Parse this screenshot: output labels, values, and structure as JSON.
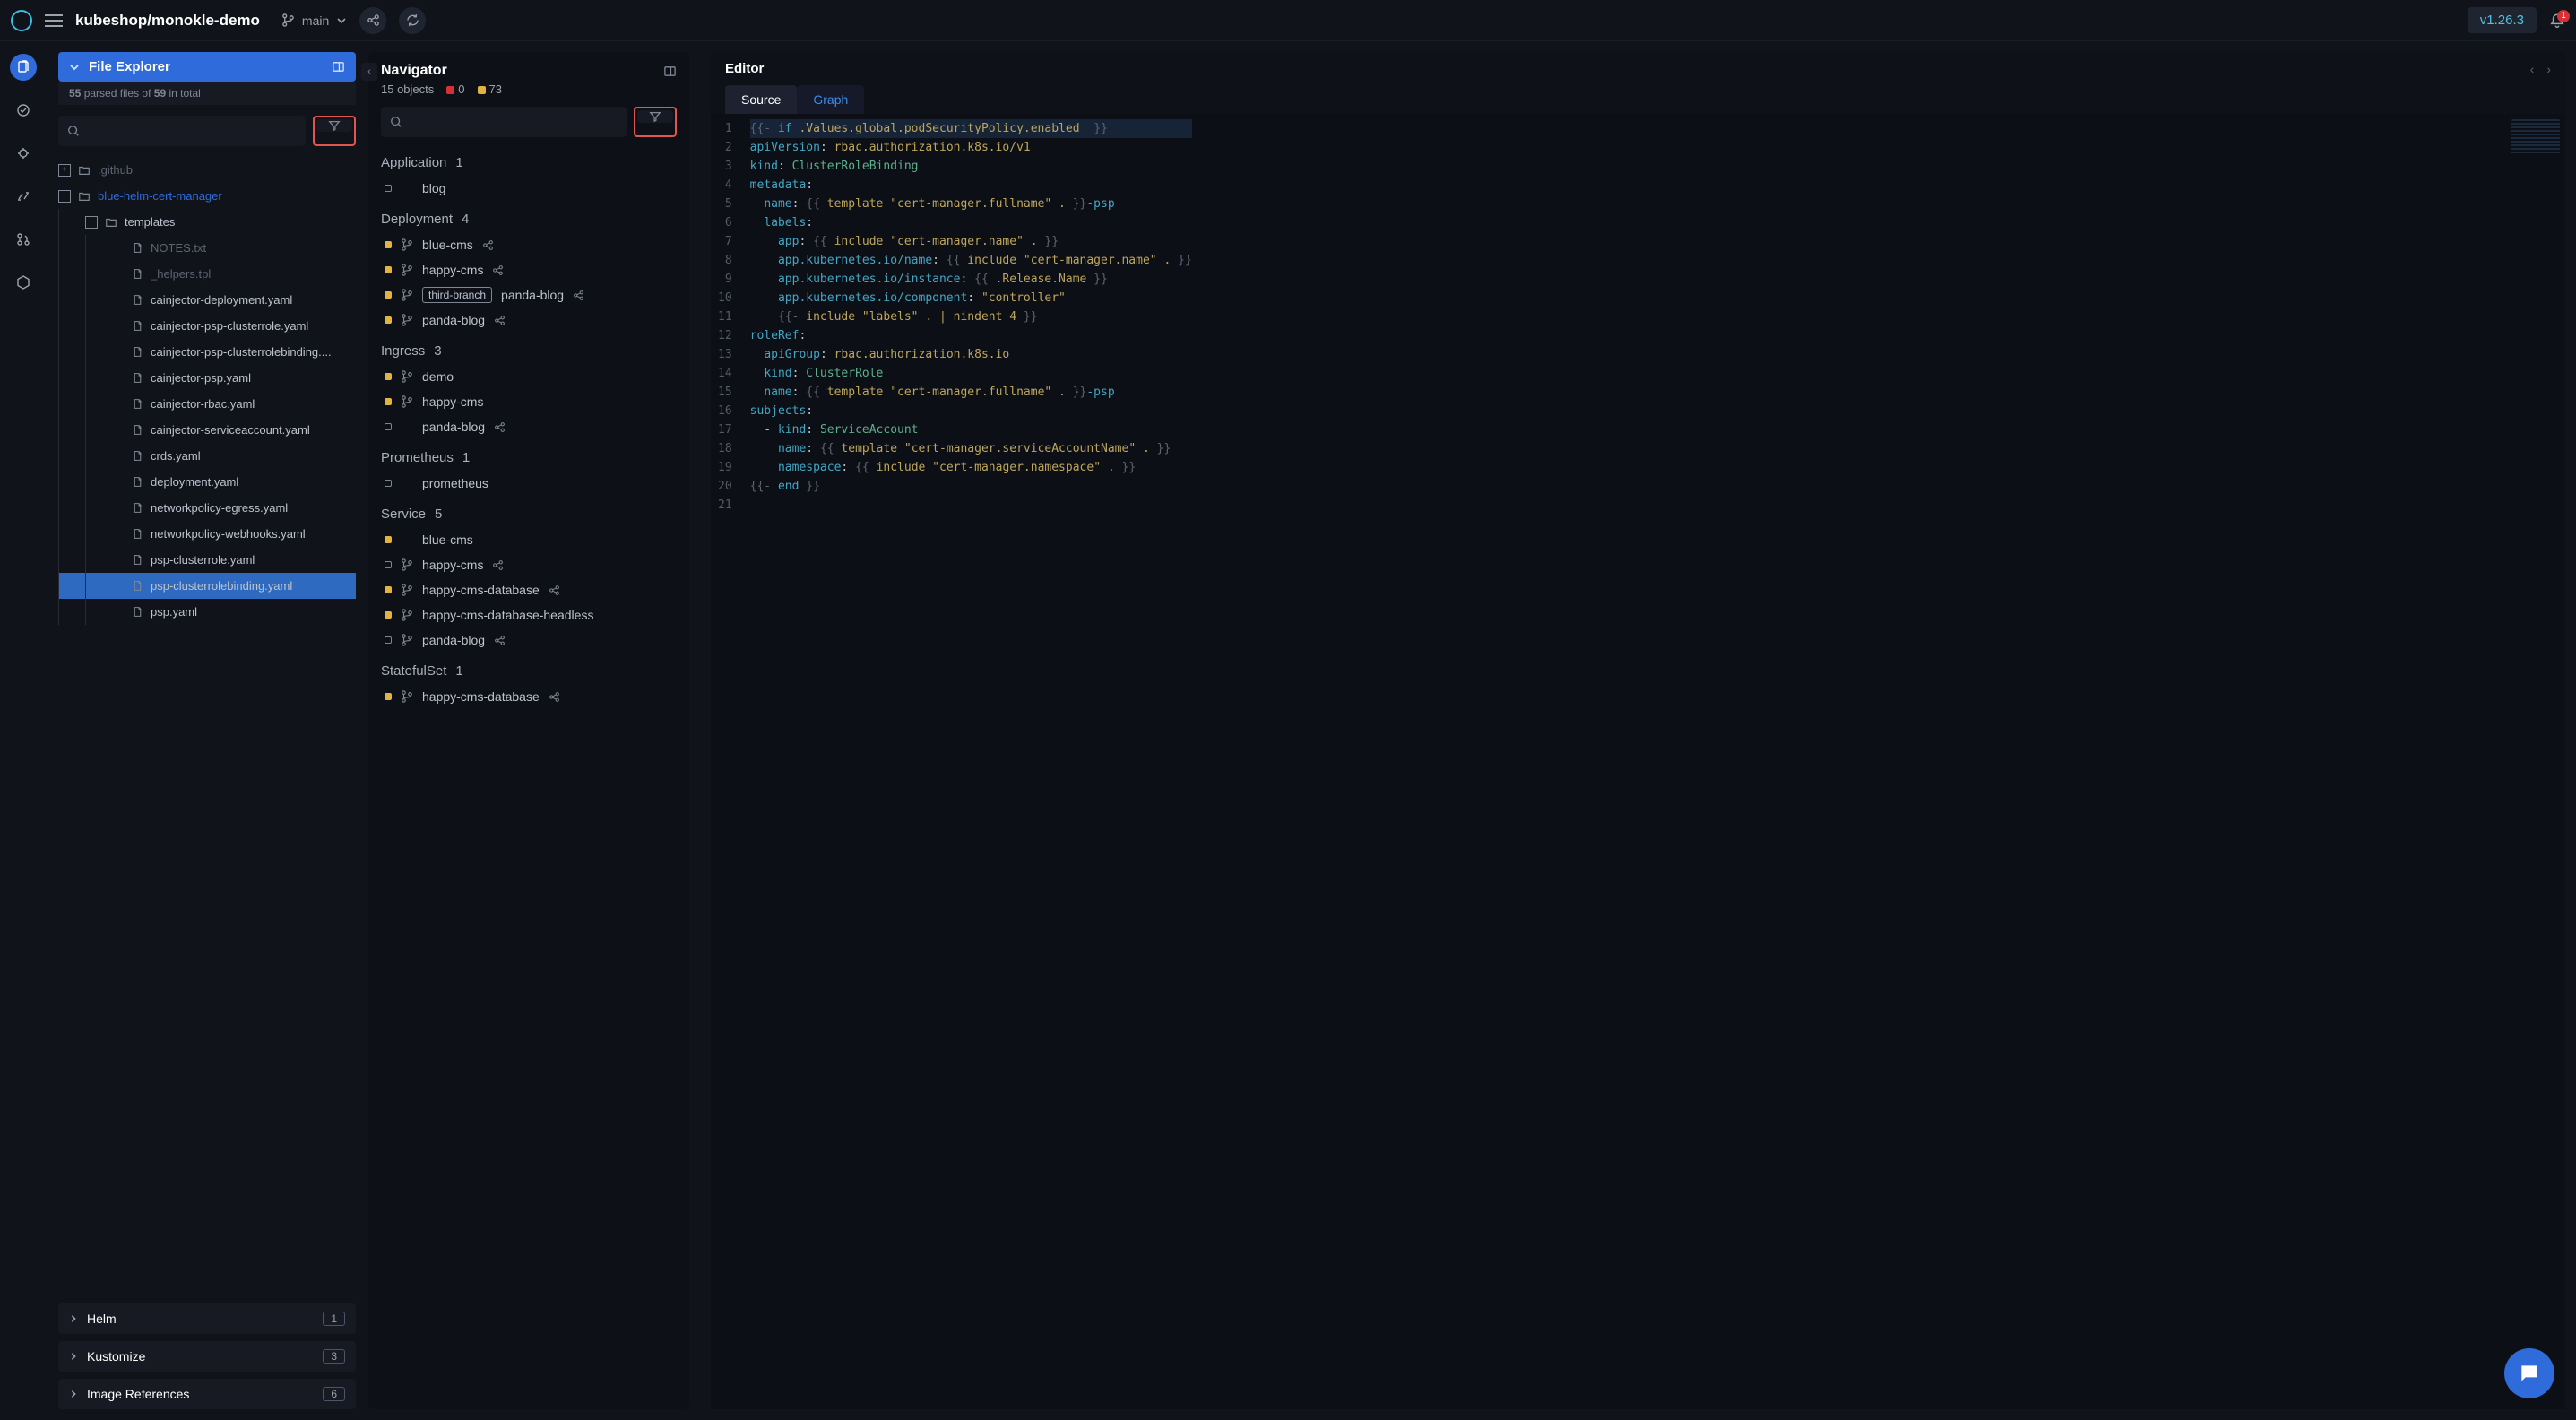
{
  "topbar": {
    "project": "kubeshop/monokle-demo",
    "branch": "main",
    "version": "v1.26.3",
    "notification_count": "1"
  },
  "file_panel": {
    "title": "File Explorer",
    "parsed_line_a": "55",
    "parsed_line_b": "parsed files of",
    "parsed_line_c": "59",
    "parsed_line_d": "in total",
    "tree": [
      {
        "label": ".github",
        "kind": "folder",
        "depth": 0,
        "box": "plus",
        "muted": true
      },
      {
        "label": "blue-helm-cert-manager",
        "kind": "folder",
        "depth": 0,
        "box": "minus",
        "blue": true
      },
      {
        "label": "templates",
        "kind": "folder",
        "depth": 1,
        "box": "minus"
      },
      {
        "label": "NOTES.txt",
        "kind": "file",
        "depth": 2,
        "muted": true
      },
      {
        "label": "_helpers.tpl",
        "kind": "file",
        "depth": 2,
        "muted": true
      },
      {
        "label": "cainjector-deployment.yaml",
        "kind": "file",
        "depth": 2
      },
      {
        "label": "cainjector-psp-clusterrole.yaml",
        "kind": "file",
        "depth": 2
      },
      {
        "label": "cainjector-psp-clusterrolebinding....",
        "kind": "file",
        "depth": 2
      },
      {
        "label": "cainjector-psp.yaml",
        "kind": "file",
        "depth": 2
      },
      {
        "label": "cainjector-rbac.yaml",
        "kind": "file",
        "depth": 2
      },
      {
        "label": "cainjector-serviceaccount.yaml",
        "kind": "file",
        "depth": 2
      },
      {
        "label": "crds.yaml",
        "kind": "file",
        "depth": 2
      },
      {
        "label": "deployment.yaml",
        "kind": "file",
        "depth": 2
      },
      {
        "label": "networkpolicy-egress.yaml",
        "kind": "file",
        "depth": 2
      },
      {
        "label": "networkpolicy-webhooks.yaml",
        "kind": "file",
        "depth": 2
      },
      {
        "label": "psp-clusterrole.yaml",
        "kind": "file",
        "depth": 2
      },
      {
        "label": "psp-clusterrolebinding.yaml",
        "kind": "file",
        "depth": 2,
        "selected": true
      },
      {
        "label": "psp.yaml",
        "kind": "file",
        "depth": 2
      }
    ],
    "accordions": [
      {
        "title": "Helm",
        "count": "1"
      },
      {
        "title": "Kustomize",
        "count": "3"
      },
      {
        "title": "Image References",
        "count": "6"
      }
    ]
  },
  "navigator": {
    "title": "Navigator",
    "objects_text": "15 objects",
    "count_red": "0",
    "count_yellow": "73",
    "groups": [
      {
        "name": "Application",
        "count": "1",
        "items": [
          {
            "label": "blog",
            "dot": "hollow"
          }
        ]
      },
      {
        "name": "Deployment",
        "count": "4",
        "items": [
          {
            "label": "blue-cms",
            "dot": "filled",
            "git": true,
            "share": true
          },
          {
            "label": "happy-cms",
            "dot": "filled",
            "git": true,
            "share": true
          },
          {
            "label": "panda-blog",
            "dot": "filled",
            "git": true,
            "share": true,
            "chip": "third-branch"
          },
          {
            "label": "panda-blog",
            "dot": "filled",
            "git": true,
            "share": true
          }
        ]
      },
      {
        "name": "Ingress",
        "count": "3",
        "items": [
          {
            "label": "demo",
            "dot": "filled",
            "git": true
          },
          {
            "label": "happy-cms",
            "dot": "filled",
            "git": true
          },
          {
            "label": "panda-blog",
            "dot": "hollow",
            "share": true
          }
        ]
      },
      {
        "name": "Prometheus",
        "count": "1",
        "items": [
          {
            "label": "prometheus",
            "dot": "hollow"
          }
        ]
      },
      {
        "name": "Service",
        "count": "5",
        "items": [
          {
            "label": "blue-cms",
            "dot": "filled"
          },
          {
            "label": "happy-cms",
            "dot": "hollow",
            "git": true,
            "share": true
          },
          {
            "label": "happy-cms-database",
            "dot": "filled",
            "git": true,
            "share": true
          },
          {
            "label": "happy-cms-database-headless",
            "dot": "filled",
            "git": true
          },
          {
            "label": "panda-blog",
            "dot": "hollow",
            "git": true,
            "share": true
          }
        ]
      },
      {
        "name": "StatefulSet",
        "count": "1",
        "items": [
          {
            "label": "happy-cms-database",
            "dot": "filled",
            "git": true,
            "share": true
          }
        ]
      }
    ]
  },
  "editor": {
    "title": "Editor",
    "tabs": {
      "source": "Source",
      "graph": "Graph"
    },
    "lines": [
      [
        [
          "c-cond",
          "{{-"
        ],
        [
          "c-punc",
          " "
        ],
        [
          "c-key",
          "if"
        ],
        [
          "c-punc",
          " "
        ],
        [
          "c-str",
          ".Values.global.podSecurityPolicy.enabled"
        ],
        [
          "c-punc",
          "  "
        ],
        [
          "c-cond",
          "}}"
        ]
      ],
      [
        [
          "c-key",
          "apiVersion"
        ],
        [
          "c-punc",
          ": "
        ],
        [
          "c-str",
          "rbac.authorization.k8s.io/v1"
        ]
      ],
      [
        [
          "c-key",
          "kind"
        ],
        [
          "c-punc",
          ": "
        ],
        [
          "c-val",
          "ClusterRoleBinding"
        ]
      ],
      [
        [
          "c-key",
          "metadata"
        ],
        [
          "c-punc",
          ":"
        ]
      ],
      [
        [
          "c-punc",
          "  "
        ],
        [
          "c-key",
          "name"
        ],
        [
          "c-punc",
          ": "
        ],
        [
          "c-cond",
          "{{"
        ],
        [
          "c-punc",
          " "
        ],
        [
          "c-str",
          "template \"cert-manager.fullname\" ."
        ],
        [
          "c-punc",
          " "
        ],
        [
          "c-cond",
          "}}"
        ],
        [
          "c-key",
          "-psp"
        ]
      ],
      [
        [
          "c-punc",
          "  "
        ],
        [
          "c-key",
          "labels"
        ],
        [
          "c-punc",
          ":"
        ]
      ],
      [
        [
          "c-punc",
          "    "
        ],
        [
          "c-key",
          "app"
        ],
        [
          "c-punc",
          ": "
        ],
        [
          "c-cond",
          "{{"
        ],
        [
          "c-punc",
          " "
        ],
        [
          "c-str",
          "include \"cert-manager.name\" ."
        ],
        [
          "c-punc",
          " "
        ],
        [
          "c-cond",
          "}}"
        ]
      ],
      [
        [
          "c-punc",
          "    "
        ],
        [
          "c-key",
          "app.kubernetes.io/name"
        ],
        [
          "c-punc",
          ": "
        ],
        [
          "c-cond",
          "{{"
        ],
        [
          "c-punc",
          " "
        ],
        [
          "c-str",
          "include \"cert-manager.name\" ."
        ],
        [
          "c-punc",
          " "
        ],
        [
          "c-cond",
          "}}"
        ]
      ],
      [
        [
          "c-punc",
          "    "
        ],
        [
          "c-key",
          "app.kubernetes.io/instance"
        ],
        [
          "c-punc",
          ": "
        ],
        [
          "c-cond",
          "{{"
        ],
        [
          "c-punc",
          " "
        ],
        [
          "c-str",
          ".Release.Name"
        ],
        [
          "c-punc",
          " "
        ],
        [
          "c-cond",
          "}}"
        ]
      ],
      [
        [
          "c-punc",
          "    "
        ],
        [
          "c-key",
          "app.kubernetes.io/component"
        ],
        [
          "c-punc",
          ": "
        ],
        [
          "c-str",
          "\"controller\""
        ]
      ],
      [
        [
          "c-punc",
          "    "
        ],
        [
          "c-cond",
          "{{-"
        ],
        [
          "c-punc",
          " "
        ],
        [
          "c-str",
          "include \"labels\" . | nindent 4"
        ],
        [
          "c-punc",
          " "
        ],
        [
          "c-cond",
          "}}"
        ]
      ],
      [
        [
          "c-key",
          "roleRef"
        ],
        [
          "c-punc",
          ":"
        ]
      ],
      [
        [
          "c-punc",
          "  "
        ],
        [
          "c-key",
          "apiGroup"
        ],
        [
          "c-punc",
          ": "
        ],
        [
          "c-str",
          "rbac.authorization.k8s.io"
        ]
      ],
      [
        [
          "c-punc",
          "  "
        ],
        [
          "c-key",
          "kind"
        ],
        [
          "c-punc",
          ": "
        ],
        [
          "c-val",
          "ClusterRole"
        ]
      ],
      [
        [
          "c-punc",
          "  "
        ],
        [
          "c-key",
          "name"
        ],
        [
          "c-punc",
          ": "
        ],
        [
          "c-cond",
          "{{"
        ],
        [
          "c-punc",
          " "
        ],
        [
          "c-str",
          "template \"cert-manager.fullname\" ."
        ],
        [
          "c-punc",
          " "
        ],
        [
          "c-cond",
          "}}"
        ],
        [
          "c-key",
          "-psp"
        ]
      ],
      [
        [
          "c-key",
          "subjects"
        ],
        [
          "c-punc",
          ":"
        ]
      ],
      [
        [
          "c-punc",
          "  - "
        ],
        [
          "c-key",
          "kind"
        ],
        [
          "c-punc",
          ": "
        ],
        [
          "c-val",
          "ServiceAccount"
        ]
      ],
      [
        [
          "c-punc",
          "    "
        ],
        [
          "c-key",
          "name"
        ],
        [
          "c-punc",
          ": "
        ],
        [
          "c-cond",
          "{{"
        ],
        [
          "c-punc",
          " "
        ],
        [
          "c-str",
          "template \"cert-manager.serviceAccountName\" ."
        ],
        [
          "c-punc",
          " "
        ],
        [
          "c-cond",
          "}}"
        ]
      ],
      [
        [
          "c-punc",
          "    "
        ],
        [
          "c-key",
          "namespace"
        ],
        [
          "c-punc",
          ": "
        ],
        [
          "c-cond",
          "{{"
        ],
        [
          "c-punc",
          " "
        ],
        [
          "c-str",
          "include \"cert-manager.namespace\" ."
        ],
        [
          "c-punc",
          " "
        ],
        [
          "c-cond",
          "}}"
        ]
      ],
      [
        [
          "c-cond",
          "{{-"
        ],
        [
          "c-punc",
          " "
        ],
        [
          "c-key",
          "end"
        ],
        [
          "c-punc",
          " "
        ],
        [
          "c-cond",
          "}}"
        ]
      ],
      [
        [
          "c-punc",
          ""
        ]
      ]
    ]
  }
}
